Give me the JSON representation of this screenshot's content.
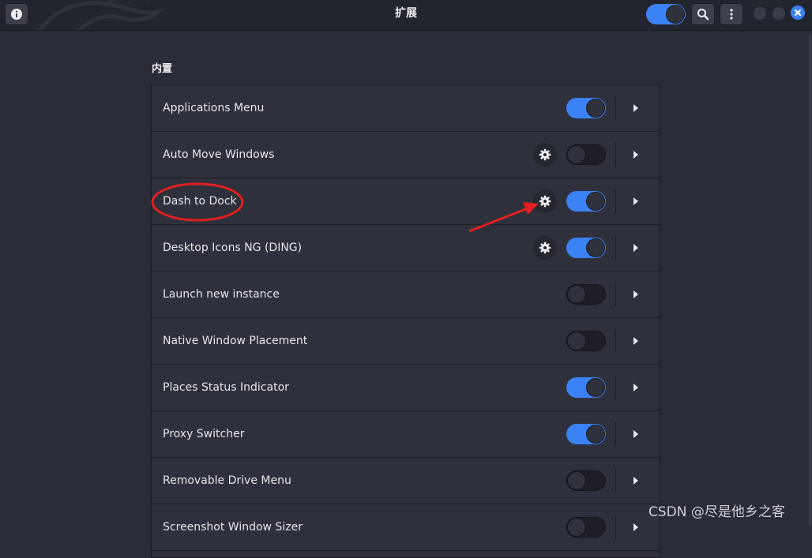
{
  "header": {
    "title": "扩展",
    "global_switch_on": true
  },
  "section": {
    "title": "内置"
  },
  "extensions": [
    {
      "name": "Applications Menu",
      "enabled": true,
      "has_settings": false
    },
    {
      "name": "Auto Move Windows",
      "enabled": false,
      "has_settings": true
    },
    {
      "name": "Dash to Dock",
      "enabled": true,
      "has_settings": true
    },
    {
      "name": "Desktop Icons NG (DING)",
      "enabled": true,
      "has_settings": true
    },
    {
      "name": "Launch new instance",
      "enabled": false,
      "has_settings": false
    },
    {
      "name": "Native Window Placement",
      "enabled": false,
      "has_settings": false
    },
    {
      "name": "Places Status Indicator",
      "enabled": true,
      "has_settings": false
    },
    {
      "name": "Proxy Switcher",
      "enabled": true,
      "has_settings": false
    },
    {
      "name": "Removable Drive Menu",
      "enabled": false,
      "has_settings": false
    },
    {
      "name": "Screenshot Window Sizer",
      "enabled": false,
      "has_settings": false
    }
  ],
  "colors": {
    "accent": "#3b82f6",
    "annotation": "#e3201f"
  },
  "watermark": "CSDN @尽是他乡之客"
}
